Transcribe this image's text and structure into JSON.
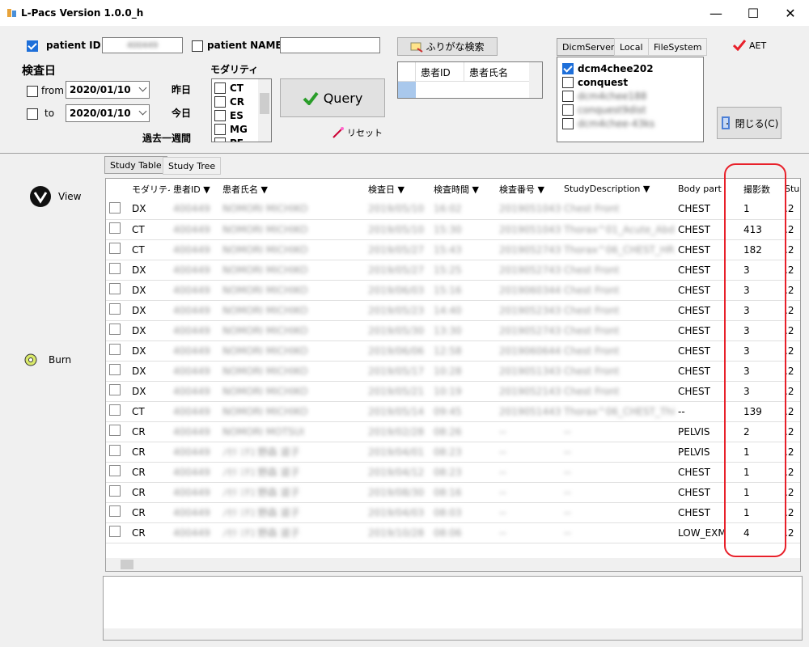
{
  "window": {
    "title": "L-Pacs Version  1.0.0_h",
    "minimize": "—",
    "maximize": "☐",
    "close": "✕"
  },
  "search": {
    "patient_id_label": "patient ID",
    "patient_id_value": "400449",
    "patient_name_label": "patient NAME",
    "patient_name_value": "",
    "exam_date_label": "検査日",
    "from_label": "from",
    "from_date": "2020/01/10",
    "to_label": "to",
    "to_date": "2020/01/10",
    "yesterday": "昨日",
    "today": "今日",
    "past_week": "過去一週間",
    "modality_label": "モダリティ",
    "modalities": [
      "CT",
      "CR",
      "ES",
      "MG",
      "PF"
    ],
    "query": "Query",
    "reset": "リセット",
    "furigana_search": "ふりがな検索",
    "furigana_cols": [
      "患者ID",
      "患者氏名"
    ]
  },
  "server": {
    "tabs": [
      "DicmServer",
      "Local",
      "FileSystem"
    ],
    "aet": "AET",
    "items": [
      {
        "name": "dcm4chee202",
        "checked": true
      },
      {
        "name": "conquest",
        "checked": false
      },
      {
        "name": "dcm4chee188",
        "checked": false
      },
      {
        "name": "conquest9dist",
        "checked": false
      },
      {
        "name": "dcm4chee-43ks",
        "checked": false
      }
    ],
    "close": "閉じる(C)"
  },
  "left_panel": {
    "view": "View",
    "burn": "Burn"
  },
  "tabs": {
    "study_table": "Study Table",
    "study_tree": "Study Tree"
  },
  "table": {
    "headers": [
      "モダリティ",
      "患者ID ▼",
      "患者氏名 ▼",
      "検査日 ▼",
      "検査時間 ▼",
      "検査番号 ▼",
      "StudyDescription ▼",
      "Body part",
      "撮影数",
      "Stu"
    ],
    "rows": [
      [
        "DX",
        "400449",
        "NOMORI MICHIKO",
        "2019/05/10",
        "16:02",
        "20190510431",
        "Chest Front",
        "CHEST",
        "1",
        ".2"
      ],
      [
        "CT",
        "400449",
        "NOMORI MICHIKO",
        "2019/05/10",
        "15:30",
        "20190510431",
        "Thorax^01_Acute_Abd",
        "CHEST",
        "413",
        ".2"
      ],
      [
        "CT",
        "400449",
        "NOMORI MICHIKO",
        "2019/05/27",
        "15:43",
        "20190527436",
        "Thorax^06_CHEST_HR",
        "CHEST",
        "182",
        ".2"
      ],
      [
        "DX",
        "400449",
        "NOMORI MICHIKO",
        "2019/05/27",
        "15:25",
        "20190527436",
        "Chest Front",
        "CHEST",
        "3",
        ".2"
      ],
      [
        "DX",
        "400449",
        "NOMORI MICHIKO",
        "2019/06/03",
        "15:16",
        "20190603444",
        "Chest Front",
        "CHEST",
        "3",
        ".2"
      ],
      [
        "DX",
        "400449",
        "NOMORI MICHIKO",
        "2019/05/23",
        "14:40",
        "20190523436",
        "Chest Front",
        "CHEST",
        "3",
        ".2"
      ],
      [
        "DX",
        "400449",
        "NOMORI MICHIKO",
        "2019/05/30",
        "13:30",
        "20190527436",
        "Chest Front",
        "CHEST",
        "3",
        ".2"
      ],
      [
        "DX",
        "400449",
        "NOMORI MICHIKO",
        "2019/06/06",
        "12:58",
        "20190606444",
        "Chest Front",
        "CHEST",
        "3",
        ".2"
      ],
      [
        "DX",
        "400449",
        "NOMORI MICHIKO",
        "2019/05/17",
        "10:28",
        "20190513436",
        "Chest Front",
        "CHEST",
        "3",
        ".2"
      ],
      [
        "DX",
        "400449",
        "NOMORI MICHIKO",
        "2019/05/21",
        "10:19",
        "20190521436",
        "Chest Front",
        "CHEST",
        "3",
        ".2"
      ],
      [
        "CT",
        "400449",
        "NOMORI MICHIKO",
        "2019/05/14",
        "09:45",
        "20190514436",
        "Thorax^06_CHEST_Thi",
        "--",
        "139",
        ".2"
      ],
      [
        "CR",
        "400449",
        "NOMORI MOTSUI",
        "2019/02/28",
        "08:26",
        "--",
        "--",
        "PELVIS",
        "2",
        ".2"
      ],
      [
        "CR",
        "400449",
        "ﾉﾓﾘ ﾐﾁｺ 野森 道子",
        "2019/04/01",
        "08:23",
        "--",
        "--",
        "PELVIS",
        "1",
        ".2"
      ],
      [
        "CR",
        "400449",
        "ﾉﾓﾘ ﾐﾁｺ 野森 道子",
        "2019/04/12",
        "08:23",
        "--",
        "--",
        "CHEST",
        "1",
        ".2"
      ],
      [
        "CR",
        "400449",
        "ﾉﾓﾘ ﾐﾁｺ 野森 道子",
        "2019/08/30",
        "08:16",
        "--",
        "--",
        "CHEST",
        "1",
        ".2"
      ],
      [
        "CR",
        "400449",
        "ﾉﾓﾘ ﾐﾁｺ 野森 道子",
        "2019/04/03",
        "08:03",
        "--",
        "--",
        "CHEST",
        "1",
        ".2"
      ],
      [
        "CR",
        "400449",
        "ﾉﾓﾘ ﾐﾁｺ 野森 道子",
        "2019/10/28",
        "08:06",
        "--",
        "--",
        "LOW_EXM",
        "4",
        ".2"
      ]
    ]
  },
  "colors": {
    "accent": "#1e6fd9",
    "highlight": "#e8202a"
  }
}
